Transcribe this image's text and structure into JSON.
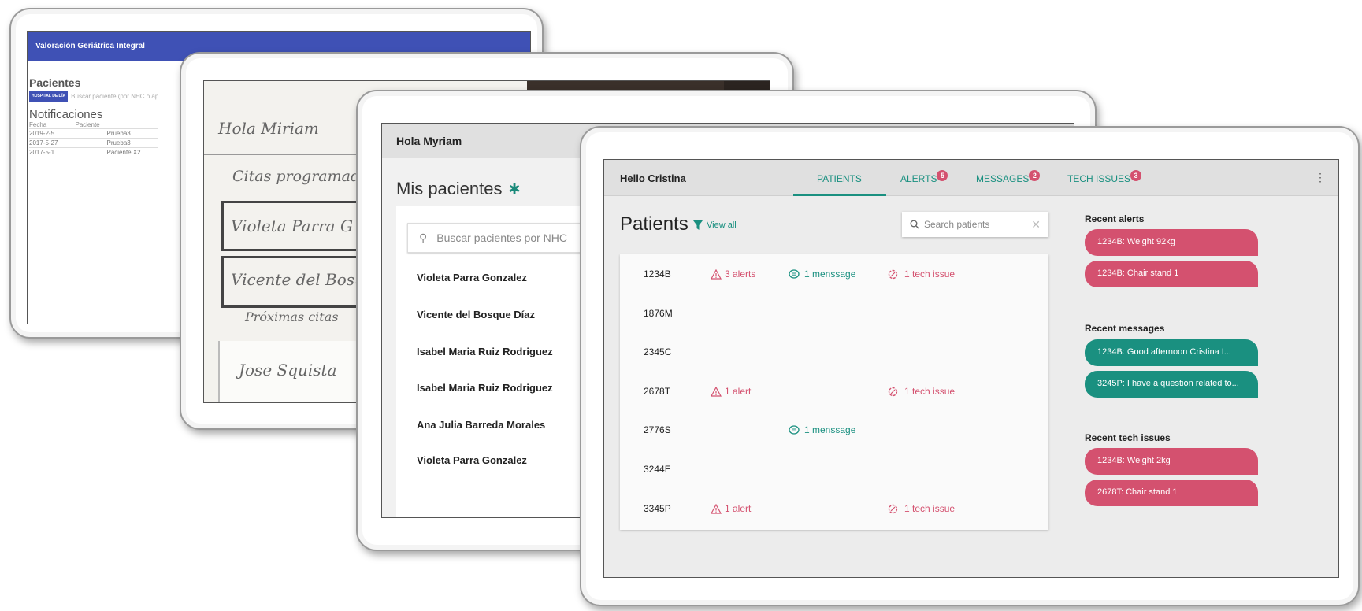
{
  "tablet1": {
    "app_title": "Valoración Geriátrica Integral",
    "section_title": "Pacientes",
    "hospital_button": "HOSPITAL DE DÍA",
    "search_placeholder": "Buscar paciente (por NHC o ap",
    "notifications_title": "Notificaciones",
    "columns": [
      "Fecha",
      "Paciente"
    ],
    "rows": [
      {
        "fecha": "2019-2-5",
        "paciente": "Prueba3"
      },
      {
        "fecha": "2017-5-27",
        "paciente": "Prueba3"
      },
      {
        "fecha": "2017-5-1",
        "paciente": "Paciente X2"
      }
    ]
  },
  "tablet2": {
    "sketch_lines": [
      "Hola Miriam",
      "Citas programadas",
      "Violeta Parra G",
      "Vicente del Bosq",
      "Próximas citas",
      "Jose Squista"
    ]
  },
  "tablet3": {
    "greeting": "Hola Myriam",
    "title": "Mis pacientes",
    "search_placeholder": "Buscar pacientes por NHC",
    "patients": [
      "Violeta Parra Gonzalez",
      "Vicente del Bosque Díaz",
      "Isabel Maria Ruiz Rodriguez",
      "Isabel Maria Ruiz Rodriguez",
      "Ana Julia Barreda Morales",
      "Violeta Parra Gonzalez"
    ]
  },
  "tablet4": {
    "greeting": "Hello Cristina",
    "tabs": [
      {
        "label": "PATIENTS",
        "badge": ""
      },
      {
        "label": "ALERTS",
        "badge": "5"
      },
      {
        "label": "MESSAGES",
        "badge": "2"
      },
      {
        "label": "TECH ISSUES",
        "badge": "3"
      }
    ],
    "page_title": "Patients",
    "view_all": "View all",
    "search_placeholder": "Search patients",
    "patients": [
      {
        "id": "1234B",
        "alerts": "3 alerts",
        "messages": "1 menssage",
        "tech": "1 tech issue"
      },
      {
        "id": "1876M",
        "alerts": "",
        "messages": "",
        "tech": ""
      },
      {
        "id": "2345C",
        "alerts": "",
        "messages": "",
        "tech": ""
      },
      {
        "id": "2678T",
        "alerts": "1 alert",
        "messages": "",
        "tech": "1 tech issue"
      },
      {
        "id": "2776S",
        "alerts": "",
        "messages": "1 menssage",
        "tech": ""
      },
      {
        "id": "3244E",
        "alerts": "",
        "messages": "",
        "tech": ""
      },
      {
        "id": "3345P",
        "alerts": "1 alert",
        "messages": "",
        "tech": "1 tech issue"
      }
    ],
    "recent_alerts_title": "Recent alerts",
    "recent_alerts": [
      "1234B: Weight 92kg",
      "1234B: Chair stand 1"
    ],
    "recent_messages_title": "Recent messages",
    "recent_messages": [
      "1234B: Good afternoon Cristina I...",
      "3245P: I have a question related to..."
    ],
    "recent_tech_title": "Recent tech issues",
    "recent_tech": [
      "1234B: Weight 2kg",
      "2678T: Chair stand 1"
    ],
    "colors": {
      "accent": "#1a9080",
      "alert": "#d4516f",
      "indigo": "#3f51b5"
    }
  }
}
